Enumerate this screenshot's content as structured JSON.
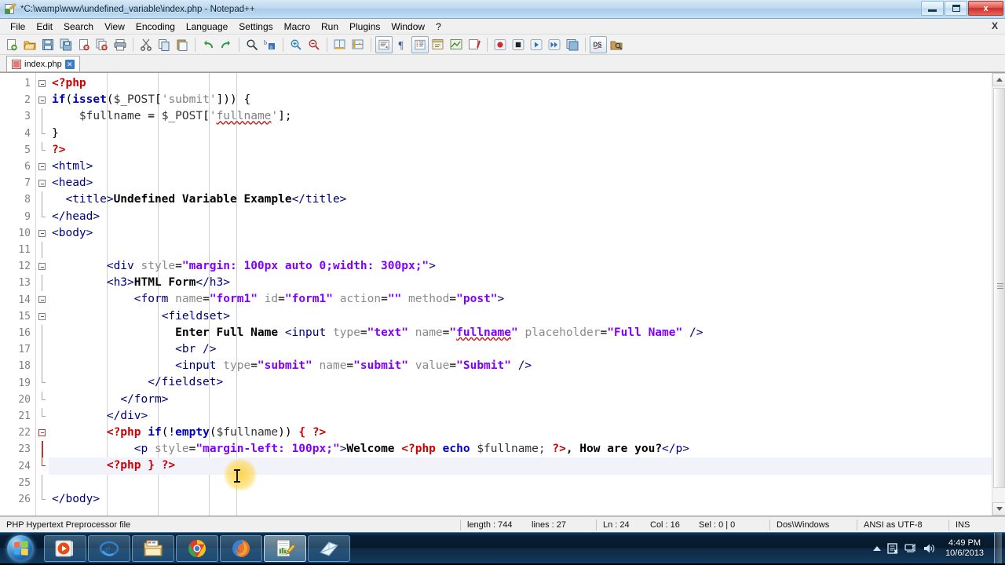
{
  "window": {
    "title": "*C:\\wamp\\www\\undefined_variable\\index.php - Notepad++",
    "icon": "notepad-plus-plus-icon",
    "minimize_label": "Minimize",
    "maximize_label": "Restore",
    "close_label": "x"
  },
  "menu": {
    "items": [
      {
        "label": "File"
      },
      {
        "label": "Edit"
      },
      {
        "label": "Search"
      },
      {
        "label": "View"
      },
      {
        "label": "Encoding"
      },
      {
        "label": "Language"
      },
      {
        "label": "Settings"
      },
      {
        "label": "Macro"
      },
      {
        "label": "Run"
      },
      {
        "label": "Plugins"
      },
      {
        "label": "Window"
      },
      {
        "label": "?"
      }
    ],
    "close_document": "X"
  },
  "toolbar": {
    "buttons": [
      {
        "name": "new-file-icon",
        "tip": "New"
      },
      {
        "name": "open-file-icon",
        "tip": "Open"
      },
      {
        "name": "save-icon",
        "tip": "Save"
      },
      {
        "name": "save-all-icon",
        "tip": "Save All"
      },
      {
        "name": "close-file-icon",
        "tip": "Close"
      },
      {
        "name": "close-all-icon",
        "tip": "Close All"
      },
      {
        "name": "print-icon",
        "tip": "Print"
      },
      {
        "name": "cut-icon",
        "tip": "Cut"
      },
      {
        "name": "copy-icon",
        "tip": "Copy"
      },
      {
        "name": "paste-icon",
        "tip": "Paste"
      },
      {
        "name": "undo-icon",
        "tip": "Undo"
      },
      {
        "name": "redo-icon",
        "tip": "Redo"
      },
      {
        "name": "find-icon",
        "tip": "Find"
      },
      {
        "name": "replace-icon",
        "tip": "Replace"
      },
      {
        "name": "zoom-in-icon",
        "tip": "Zoom In"
      },
      {
        "name": "zoom-out-icon",
        "tip": "Zoom Out"
      },
      {
        "name": "sync-vertical-icon",
        "tip": "Sync Vertical Scrolling"
      },
      {
        "name": "sync-horizontal-icon",
        "tip": "Sync Horizontal Scrolling"
      },
      {
        "name": "word-wrap-icon",
        "tip": "Word wrap"
      },
      {
        "name": "show-all-chars-icon",
        "tip": "Show All Characters"
      },
      {
        "name": "indent-guide-icon",
        "tip": "Show Indent Guide"
      },
      {
        "name": "user-defined-dlg-icon",
        "tip": "User Defined Dialogue"
      },
      {
        "name": "document-map-icon",
        "tip": "Document Map"
      },
      {
        "name": "function-list-icon",
        "tip": "Function List"
      },
      {
        "name": "record-macro-icon",
        "tip": "Start Recording"
      },
      {
        "name": "stop-macro-icon",
        "tip": "Stop Recording"
      },
      {
        "name": "play-macro-icon",
        "tip": "Playback"
      },
      {
        "name": "run-multi-macro-icon",
        "tip": "Run a Macro Multiple Times"
      },
      {
        "name": "save-macro-icon",
        "tip": "Save Current Recorded Macro"
      },
      {
        "name": "ds-icon",
        "tip": "DSpellCheck"
      },
      {
        "name": "explorer-icon",
        "tip": "Explorer"
      }
    ]
  },
  "tabs": [
    {
      "label": "index.php",
      "close": "✕",
      "active": true
    }
  ],
  "editor": {
    "current_line": 24,
    "total_lines_shown": 26,
    "lines": [
      {
        "n": 1,
        "fold": "open",
        "html": "<span class=\"s-php\">&lt;?php</span>"
      },
      {
        "n": 2,
        "fold": "open",
        "html": "<span class=\"s-kw\">if</span><span class=\"s-punc\">(</span><span class=\"s-kw\">isset</span><span class=\"s-punc\">(</span><span class=\"s-var\">$_POST</span><span class=\"s-punc\">[</span><span class=\"s-str\">'submit'</span><span class=\"s-punc\">]))</span> <span class=\"s-punc\">{</span>"
      },
      {
        "n": 3,
        "fold": "line",
        "html": "    <span class=\"s-var\">$fullname</span> <span class=\"s-punc\">=</span> <span class=\"s-var\">$_POST</span><span class=\"s-punc\">[</span><span class=\"s-str\">'<span class=\"squiggle\">fullname</span>'</span><span class=\"s-punc\">];</span>"
      },
      {
        "n": 4,
        "fold": "mid",
        "html": "<span class=\"s-punc\">}</span>"
      },
      {
        "n": 5,
        "fold": "end",
        "html": "<span class=\"s-php\">?&gt;</span>"
      },
      {
        "n": 6,
        "fold": "open",
        "html": "<span class=\"s-tag2\">&lt;html&gt;</span>"
      },
      {
        "n": 7,
        "fold": "open",
        "html": "<span class=\"s-tag2\">&lt;head&gt;</span>"
      },
      {
        "n": 8,
        "fold": "line",
        "html": "  <span class=\"s-tag2\">&lt;title&gt;</span><span class=\"s-txt\">Undefined Variable Example</span><span class=\"s-tag2\">&lt;/title&gt;</span>"
      },
      {
        "n": 9,
        "fold": "mid",
        "html": "<span class=\"s-tag2\">&lt;/head&gt;</span>"
      },
      {
        "n": 10,
        "fold": "open",
        "html": "<span class=\"s-tag2\">&lt;body&gt;</span>"
      },
      {
        "n": 11,
        "fold": "line",
        "html": ""
      },
      {
        "n": 12,
        "fold": "open",
        "html": "        <span class=\"s-tag2\">&lt;div</span> <span class=\"s-attr\">style</span><span class=\"s-punc\">=</span><span class=\"s-val\">\"margin: 100px auto 0;width: 300px;\"</span><span class=\"s-tag2\">&gt;</span>"
      },
      {
        "n": 13,
        "fold": "line",
        "html": "        <span class=\"s-tag2\">&lt;h3&gt;</span><span class=\"s-txt\">HTML Form</span><span class=\"s-tag2\">&lt;/h3&gt;</span>"
      },
      {
        "n": 14,
        "fold": "open",
        "html": "            <span class=\"s-tag2\">&lt;form</span> <span class=\"s-attr\">name</span><span class=\"s-punc\">=</span><span class=\"s-val\">\"form1\"</span> <span class=\"s-attr\">id</span><span class=\"s-punc\">=</span><span class=\"s-val\">\"form1\"</span> <span class=\"s-attr\">action</span><span class=\"s-punc\">=</span><span class=\"s-val\">\"\"</span> <span class=\"s-attr\">method</span><span class=\"s-punc\">=</span><span class=\"s-val\">\"post\"</span><span class=\"s-tag2\">&gt;</span>"
      },
      {
        "n": 15,
        "fold": "open",
        "html": "                <span class=\"s-tag2\">&lt;fieldset&gt;</span>"
      },
      {
        "n": 16,
        "fold": "line",
        "html": "                  <span class=\"s-txt\">Enter Full Name</span> <span class=\"s-tag2\">&lt;input</span> <span class=\"s-attr\">type</span><span class=\"s-punc\">=</span><span class=\"s-val\">\"text\"</span> <span class=\"s-attr\">name</span><span class=\"s-punc\">=</span><span class=\"s-val\">\"<span class=\"squiggle\">fullname</span>\"</span> <span class=\"s-attr\">placeholder</span><span class=\"s-punc\">=</span><span class=\"s-val\">\"Full Name\"</span> <span class=\"s-tag2\">/&gt;</span>"
      },
      {
        "n": 17,
        "fold": "line",
        "html": "                  <span class=\"s-tag2\">&lt;br /&gt;</span>"
      },
      {
        "n": 18,
        "fold": "line",
        "html": "                  <span class=\"s-tag2\">&lt;input</span> <span class=\"s-attr\">type</span><span class=\"s-punc\">=</span><span class=\"s-val\">\"submit\"</span> <span class=\"s-attr\">name</span><span class=\"s-punc\">=</span><span class=\"s-val\">\"submit\"</span> <span class=\"s-attr\">value</span><span class=\"s-punc\">=</span><span class=\"s-val\">\"Submit\"</span> <span class=\"s-tag2\">/&gt;</span>"
      },
      {
        "n": 19,
        "fold": "mid",
        "html": "              <span class=\"s-tag2\">&lt;/fieldset&gt;</span>"
      },
      {
        "n": 20,
        "fold": "mid",
        "html": "          <span class=\"s-tag2\">&lt;/form&gt;</span>"
      },
      {
        "n": 21,
        "fold": "mid",
        "html": "        <span class=\"s-tag2\">&lt;/div&gt;</span>"
      },
      {
        "n": 22,
        "fold": "openred",
        "html": "        <span class=\"s-php\">&lt;?php</span> <span class=\"s-kw\">if</span><span class=\"s-punc\">(!</span><span class=\"s-kw\">empty</span><span class=\"s-punc\">(</span><span class=\"s-var\">$fullname</span><span class=\"s-punc\">))</span> <span class=\"s-brace\">{</span> <span class=\"s-php\">?&gt;</span>"
      },
      {
        "n": 23,
        "fold": "linered",
        "html": "            <span class=\"s-tag2\">&lt;p</span> <span class=\"s-attr\">style</span><span class=\"s-punc\">=</span><span class=\"s-val\">\"margin-left: 100px;\"</span><span class=\"s-tag2\">&gt;</span><span class=\"s-txt\">Welcome</span> <span class=\"s-php\">&lt;?php</span> <span class=\"s-kw\">echo</span> <span class=\"s-var\">$fullname;</span> <span class=\"s-php\">?&gt;</span><span class=\"s-txt\">, How are you?</span><span class=\"s-tag2\">&lt;/p&gt;</span>"
      },
      {
        "n": 24,
        "fold": "endred",
        "html": "        <span class=\"s-php\">&lt;?php</span> <span class=\"s-brace\">}</span> <span class=\"s-php\">?&gt;</span>",
        "current": true
      },
      {
        "n": 25,
        "fold": "line",
        "html": ""
      },
      {
        "n": 26,
        "fold": "mid",
        "html": "<span class=\"s-tag2\">&lt;/body&gt;</span>"
      }
    ]
  },
  "statusbar": {
    "file_type": "PHP Hypertext Preprocessor file",
    "length": "length : 744",
    "lines": "lines : 27",
    "ln": "Ln : 24",
    "col": "Col : 16",
    "sel": "Sel : 0 | 0",
    "eol": "Dos\\Windows",
    "encoding": "ANSI as UTF-8",
    "insert_mode": "INS"
  },
  "taskbar": {
    "start_label": "Start",
    "items": [
      {
        "name": "taskbar-media-player",
        "label": "Windows Media Player"
      },
      {
        "name": "taskbar-internet-explorer",
        "label": "Internet Explorer"
      },
      {
        "name": "taskbar-file-explorer",
        "label": "Windows Explorer"
      },
      {
        "name": "taskbar-chrome",
        "label": "Google Chrome"
      },
      {
        "name": "taskbar-firefox",
        "label": "Mozilla Firefox"
      },
      {
        "name": "taskbar-notepad-plus-plus",
        "label": "Notepad++"
      },
      {
        "name": "taskbar-sticky-notes",
        "label": "Sticky Notes"
      }
    ],
    "tray": {
      "show_hidden_icons": "show-hidden-icons-arrow",
      "icons": [
        {
          "name": "action-center-icon"
        },
        {
          "name": "network-icon"
        },
        {
          "name": "volume-icon"
        }
      ],
      "time": "4:49 PM",
      "date": "10/6/2013"
    }
  },
  "colors": {
    "title_bar": "#bcd8ef",
    "menu_bg": "#f0f0f0",
    "editor_bg": "#ffffff",
    "current_line": "#f2f2fb",
    "taskbar": "#0a2036",
    "php_red": "#d00000",
    "tag_blue": "#000080",
    "attr_value_purple": "#8000ff",
    "close_button_red": "#c9302a"
  }
}
